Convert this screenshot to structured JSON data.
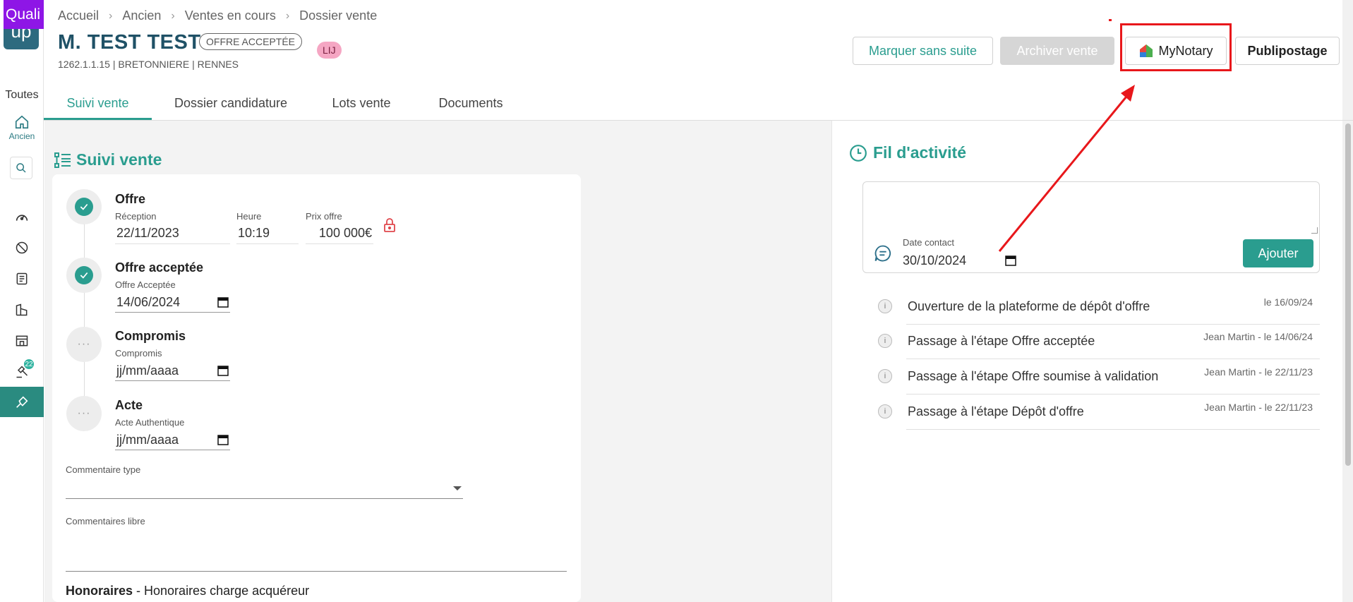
{
  "brand": {
    "badge_text": "Quali",
    "box_text": "up"
  },
  "sidebar": {
    "toutes_label": "Toutes",
    "home_label": "Ancien",
    "notification_count": "22"
  },
  "breadcrumb": [
    "Accueil",
    "Ancien",
    "Ventes en cours",
    "Dossier vente"
  ],
  "header": {
    "title": "M. TEST TEST",
    "status_badge": "OFFRE ACCEPTÉE",
    "tag_badge": "LIJ",
    "subtitle": "1262.1.1.15 | BRETONNIERE | RENNES",
    "buttons": {
      "marquer_sans_suite": "Marquer sans suite",
      "archiver_vente": "Archiver vente",
      "mynotary": "MyNotary",
      "publipostage": "Publipostage"
    }
  },
  "tabs": [
    "Suivi vente",
    "Dossier candidature",
    "Lots vente",
    "Documents"
  ],
  "suivi": {
    "section_title": "Suivi vente",
    "steps": {
      "offre": {
        "title": "Offre",
        "reception_label": "Réception",
        "reception_value": "22/11/2023",
        "heure_label": "Heure",
        "heure_value": "10:19",
        "prix_label": "Prix offre",
        "prix_value": "100 000€"
      },
      "offre_acceptee": {
        "title": "Offre acceptée",
        "field_label": "Offre Acceptée",
        "field_value": "14/06/2024"
      },
      "compromis": {
        "title": "Compromis",
        "field_label": "Compromis",
        "field_value": "jj/mm/aaaa"
      },
      "acte": {
        "title": "Acte",
        "field_label": "Acte Authentique",
        "field_value": "jj/mm/aaaa"
      }
    },
    "dots": "···",
    "commentaire_type_label": "Commentaire type",
    "commentaires_libre_label": "Commentaires libre",
    "honoraires_bold": "Honoraires",
    "honoraires_rest": " - Honoraires charge acquéreur"
  },
  "activity": {
    "title": "Fil d'activité",
    "date_contact_label": "Date contact",
    "date_contact_value": "30/10/2024",
    "add_button": "Ajouter",
    "items": [
      {
        "text": "Ouverture de la plateforme de dépôt d'offre",
        "meta": "le 16/09/24"
      },
      {
        "text": "Passage à l'étape Offre acceptée",
        "meta": "Jean Martin - le 14/06/24"
      },
      {
        "text": "Passage à l'étape Offre soumise à validation",
        "meta": "Jean Martin - le 22/11/23"
      },
      {
        "text": "Passage à l'étape Dépôt d'offre",
        "meta": "Jean Martin - le 22/11/23"
      }
    ]
  },
  "colors": {
    "accent": "#2a9d8f",
    "title": "#1f5166",
    "annotation": "#e8171b",
    "brand": "#8e16e6"
  },
  "icons": [
    "home-icon",
    "search-icon",
    "gauge-icon",
    "ban-icon",
    "list-icon",
    "building-icon",
    "storefront-icon",
    "gavel-icon",
    "handshake-icon",
    "lock-icon",
    "clock-icon",
    "chat-icon",
    "calendar-icon",
    "info-icon",
    "check-icon"
  ]
}
